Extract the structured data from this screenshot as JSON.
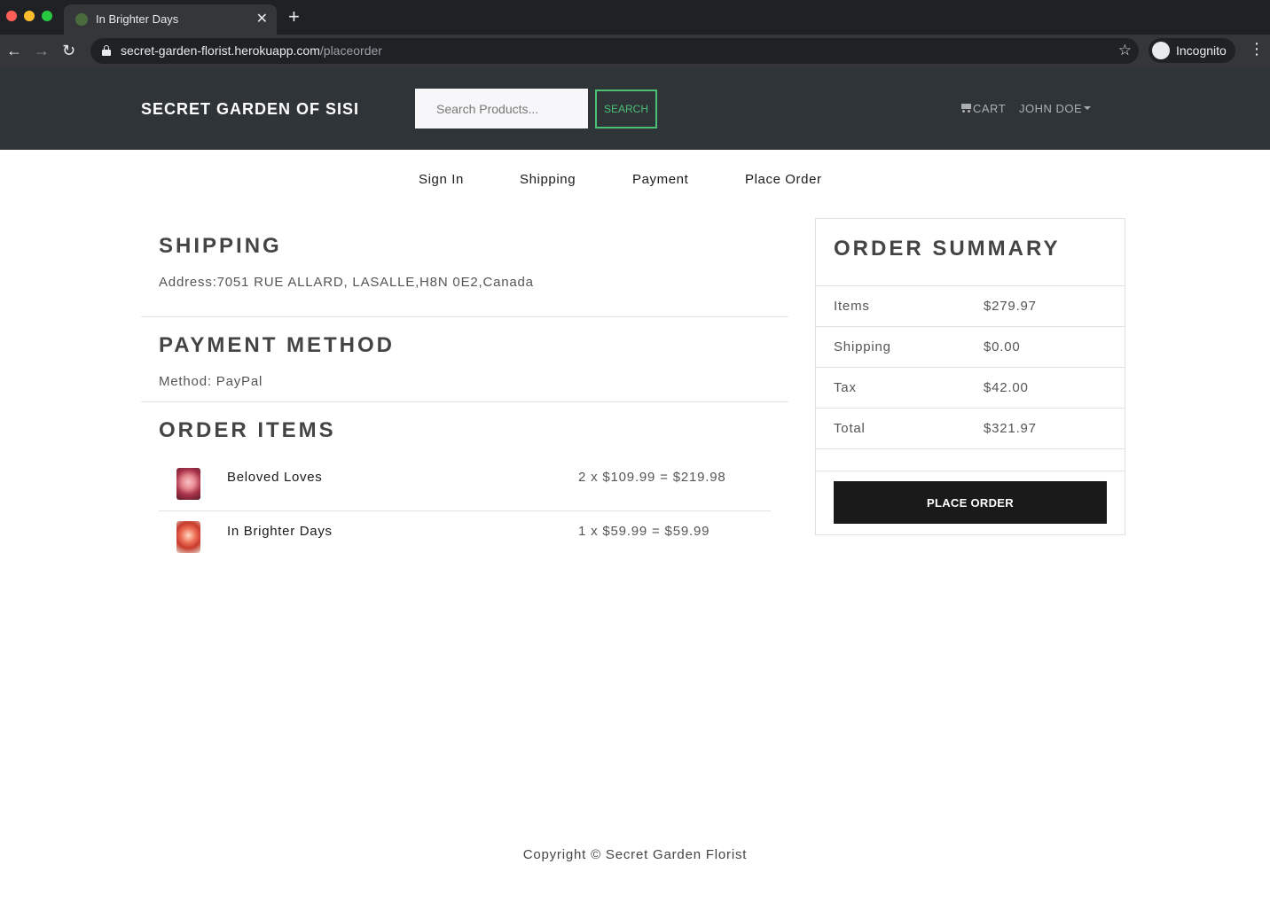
{
  "browser": {
    "tab_title": "In Brighter Days",
    "tab_close": "✕",
    "new_tab": "+",
    "url_host": "secret-garden-florist.herokuapp.com",
    "url_path": "/placeorder",
    "profile_label": "Incognito"
  },
  "header": {
    "brand": "SECRET GARDEN OF SISI",
    "search_placeholder": "Search Products...",
    "search_button": "SEARCH",
    "cart_label": "CART",
    "user_label": "JOHN DOE"
  },
  "steps": [
    "Sign In",
    "Shipping",
    "Payment",
    "Place Order"
  ],
  "shipping": {
    "title": "SHIPPING",
    "address": "Address:7051 RUE ALLARD, LASALLE,H8N 0E2,Canada"
  },
  "payment": {
    "title": "PAYMENT METHOD",
    "method": "Method: PayPal"
  },
  "order_items": {
    "title": "ORDER ITEMS",
    "items": [
      {
        "name": "Beloved Loves",
        "total": "2 x $109.99 = $219.98"
      },
      {
        "name": "In Brighter Days",
        "total": "1 x $59.99 = $59.99"
      }
    ]
  },
  "summary": {
    "title": "ORDER SUMMARY",
    "rows": [
      {
        "label": "Items",
        "value": "$279.97"
      },
      {
        "label": "Shipping",
        "value": "$0.00"
      },
      {
        "label": "Tax",
        "value": "$42.00"
      },
      {
        "label": "Total",
        "value": "$321.97"
      }
    ],
    "button": "PLACE ORDER"
  },
  "footer": "Copyright © Secret Garden Florist",
  "colors": {
    "header_bg": "#2f3439",
    "accent_green": "#4bbf73",
    "button_dark": "#1a1a1a"
  }
}
